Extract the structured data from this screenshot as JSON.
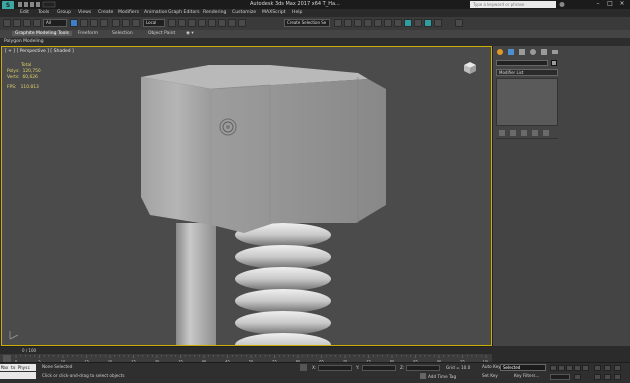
{
  "titlebar": {
    "title": "Autodesk 3ds Max 2017 x64    T_Ha...",
    "search_placeholder": "Type a keyword or phrase"
  },
  "menu": [
    "Edit",
    "Tools",
    "Group",
    "Views",
    "Create",
    "Modifiers",
    "Animation",
    "Graph Editors",
    "Rendering",
    "Customize",
    "MAXScript",
    "Help"
  ],
  "toolbar": {
    "filter": "All",
    "ref_coord": "Local",
    "selection_set": "Create Selection Se"
  },
  "ribbon": {
    "tabs": [
      "Graphite Modeling Tools",
      "Freeform",
      "Selection",
      "Object Paint"
    ],
    "active_tab": "Graphite Modeling Tools",
    "sub_label": "Polygon Modeling"
  },
  "viewport": {
    "label": "[ + ] [ Perspective ] [ Shaded ]",
    "stats_header": "Total",
    "polys_label": "Polys:",
    "polys_value": "120,750",
    "verts_label": "Verts:",
    "verts_value": "60,626",
    "fps_label": "FPS:",
    "fps_value": "110.813"
  },
  "command_panel": {
    "modifier_list": "Modifier List"
  },
  "timeline": {
    "frame": "0 / 100",
    "ticks": [
      "0",
      "5",
      "10",
      "15",
      "20",
      "25",
      "30",
      "35",
      "40",
      "45",
      "50",
      "55",
      "60",
      "65",
      "70",
      "75",
      "80",
      "85",
      "90",
      "95",
      "100"
    ]
  },
  "status": {
    "maxscript": "Max to Physc",
    "none_selected": "None Selected",
    "prompt": "Click or click-and-drag to select objects",
    "x_label": "X:",
    "y_label": "Y:",
    "z_label": "Z:",
    "grid": "Grid = 10.0",
    "add_time_tag": "Add Time Tag",
    "auto_key": "Auto Key",
    "set_key": "Set Key",
    "selected": "Selected",
    "key_filters": "Key Filters..."
  },
  "colors": {
    "viewport_border": "#c9b000",
    "viewport_bg": "#4b4b4b",
    "stats_text": "#e0d26a",
    "app_logo": "#3fa7a3"
  }
}
